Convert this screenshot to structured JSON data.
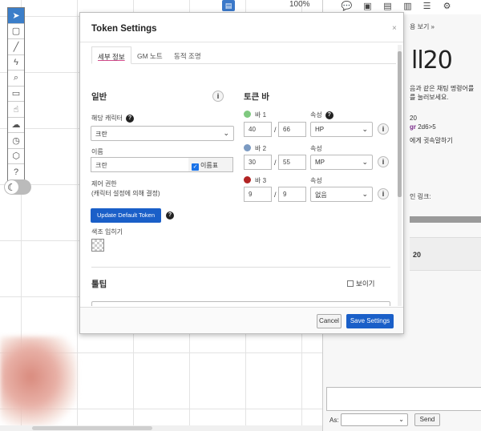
{
  "canvas": {
    "zoom_level": "100%",
    "top_marker_icon": "document-icon"
  },
  "toolbar": {
    "tools": [
      {
        "name": "select-tool",
        "icon": "pointer-icon",
        "glyph": "➤"
      },
      {
        "name": "shapes-tool",
        "icon": "cube-icon",
        "glyph": "▢"
      },
      {
        "name": "draw-tool",
        "icon": "brush-icon",
        "glyph": "╱"
      },
      {
        "name": "fx-tool",
        "icon": "lightning-icon",
        "glyph": "ϟ"
      },
      {
        "name": "zoom-tool",
        "icon": "magnifier-icon",
        "glyph": "⌕"
      },
      {
        "name": "ruler-tool",
        "icon": "ruler-icon",
        "glyph": "▭"
      },
      {
        "name": "hand-tool",
        "icon": "hand-icon",
        "glyph": "☝"
      },
      {
        "name": "fog-tool",
        "icon": "cloud-icon",
        "glyph": "☁"
      },
      {
        "name": "turn-tool",
        "icon": "clock-icon",
        "glyph": "◷"
      },
      {
        "name": "dice-tool",
        "icon": "hexagon-icon",
        "glyph": "⬡"
      },
      {
        "name": "help-tool",
        "icon": "question-icon",
        "glyph": "?"
      }
    ],
    "night_mode_glyph": "☾"
  },
  "sidebar": {
    "tabs": [
      {
        "name": "chat-tab",
        "icon": "chat-icon",
        "glyph": "💬"
      },
      {
        "name": "art-tab",
        "icon": "image-icon",
        "glyph": "▣"
      },
      {
        "name": "journal-tab",
        "icon": "newspaper-icon",
        "glyph": "▤"
      },
      {
        "name": "compendium-tab",
        "icon": "book-icon",
        "glyph": "▥"
      },
      {
        "name": "list-tab",
        "icon": "list-icon",
        "glyph": "☰"
      },
      {
        "name": "settings-tab",
        "icon": "gear-icon",
        "glyph": "⚙"
      }
    ],
    "header_link": "용 보기 »",
    "logo": "ll20",
    "chat_lines": [
      "음과 같은 채팅 명령어를",
      "를 눌러보세요.",
      "20"
    ],
    "chat_purple": "gr",
    "chat_roll": " 2d6>5",
    "chat_whisper": "에게 귓속말하기",
    "chat_link": "인 링크:",
    "strip_label": "20",
    "as_label": "As:",
    "as_value": "",
    "send_label": "Send"
  },
  "dialog": {
    "title": "Token Settings",
    "close": "×",
    "tabs": [
      "세부 정보",
      "GM 노트",
      "동적 조명"
    ],
    "general": {
      "title": "일반",
      "info": "i",
      "character_label": "해당 캐릭터",
      "character_value": "크란",
      "name_label": "이름",
      "name_value": "크란",
      "nameplate_label": "이름표",
      "control_label": "제어 권한",
      "control_sub": "(캐릭터 설정에 의해 결정)",
      "update_default": "Update Default Token",
      "tint_label": "색조 입히기"
    },
    "bars": {
      "title": "토큰 바",
      "info": "i",
      "attr_label": "속성",
      "items": [
        {
          "label": "바 1",
          "color": "#7fc97f",
          "current": "40",
          "max": "66",
          "attribute": "HP"
        },
        {
          "label": "바 2",
          "color": "#7b9ac2",
          "current": "30",
          "max": "55",
          "attribute": "MP"
        },
        {
          "label": "바 3",
          "color": "#b22424",
          "current": "9",
          "max": "9",
          "attribute": "없음"
        }
      ]
    },
    "tooltip": {
      "title": "툴팁",
      "visible_label": "보이기"
    },
    "footer": {
      "cancel": "Cancel",
      "save": "Save Settings"
    }
  }
}
